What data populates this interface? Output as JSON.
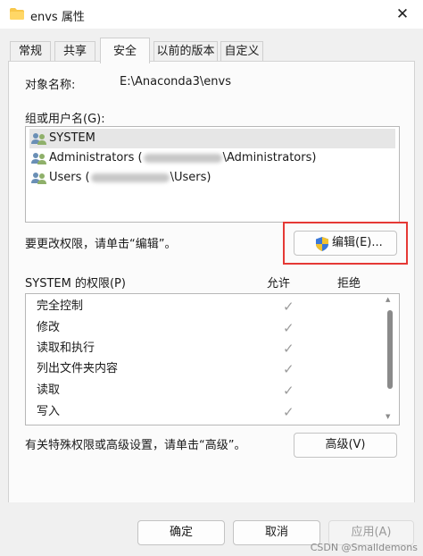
{
  "window": {
    "title": "envs 属性",
    "close_glyph": "✕"
  },
  "tabs": [
    {
      "label": "常规"
    },
    {
      "label": "共享"
    },
    {
      "label": "安全",
      "active": true
    },
    {
      "label": "以前的版本"
    },
    {
      "label": "自定义"
    }
  ],
  "object": {
    "label": "对象名称:",
    "value": "E:\\Anaconda3\\envs"
  },
  "groups": {
    "label": "组或用户名(G):",
    "items": [
      {
        "pre": "SYSTEM",
        "post": "",
        "blurred": false,
        "selected": true
      },
      {
        "pre": "Administrators (",
        "post": "\\Administrators)",
        "blurred": true,
        "selected": false
      },
      {
        "pre": "Users (",
        "post": "\\Users)",
        "blurred": true,
        "selected": false
      }
    ]
  },
  "edit": {
    "hint": "要更改权限，请单击“编辑”。",
    "button": "编辑(E)..."
  },
  "permissions": {
    "label": "SYSTEM 的权限(P)",
    "allow_header": "允许",
    "deny_header": "拒绝",
    "check_glyph": "✓",
    "rows": [
      {
        "name": "完全控制",
        "allow": true
      },
      {
        "name": "修改",
        "allow": true
      },
      {
        "name": "读取和执行",
        "allow": true
      },
      {
        "name": "列出文件夹内容",
        "allow": true
      },
      {
        "name": "读取",
        "allow": true
      },
      {
        "name": "写入",
        "allow": true
      }
    ]
  },
  "advanced": {
    "hint": "有关特殊权限或高级设置，请单击“高级”。",
    "button": "高级(V)"
  },
  "footer": {
    "ok": "确定",
    "cancel": "取消",
    "apply": "应用(A)",
    "watermark": "CSDN @Smalldemons"
  },
  "colors": {
    "highlight_box": "#e53935",
    "folder": "#f8c74a"
  }
}
